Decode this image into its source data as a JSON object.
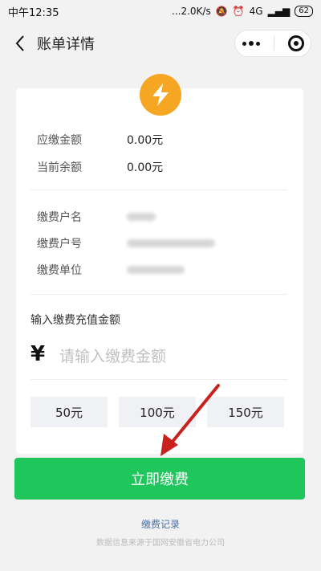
{
  "status_bar": {
    "time": "中午12:35",
    "network_speed": "...2.0K/s",
    "signal": "4G",
    "battery": "62"
  },
  "header": {
    "title": "账单详情"
  },
  "bill": {
    "rows": [
      {
        "label": "应缴金额",
        "value": "0.00元"
      },
      {
        "label": "当前余额",
        "value": "0.00元"
      }
    ],
    "account_labels": [
      "缴费户名",
      "缴费户号",
      "缴费单位"
    ]
  },
  "recharge": {
    "section_title": "输入缴费充值金额",
    "currency_symbol": "¥",
    "amount_placeholder": "请输入缴费金额",
    "amount_value": "",
    "quick_amounts": [
      "50元",
      "100元",
      "150元"
    ]
  },
  "actions": {
    "pay_label": "立即缴费",
    "record_label": "缴费记录"
  },
  "footer": {
    "note": "数据信息来源于国网安徽省电力公司"
  },
  "colors": {
    "accent": "#1ec65c",
    "icon_bg": "#f5a623"
  }
}
